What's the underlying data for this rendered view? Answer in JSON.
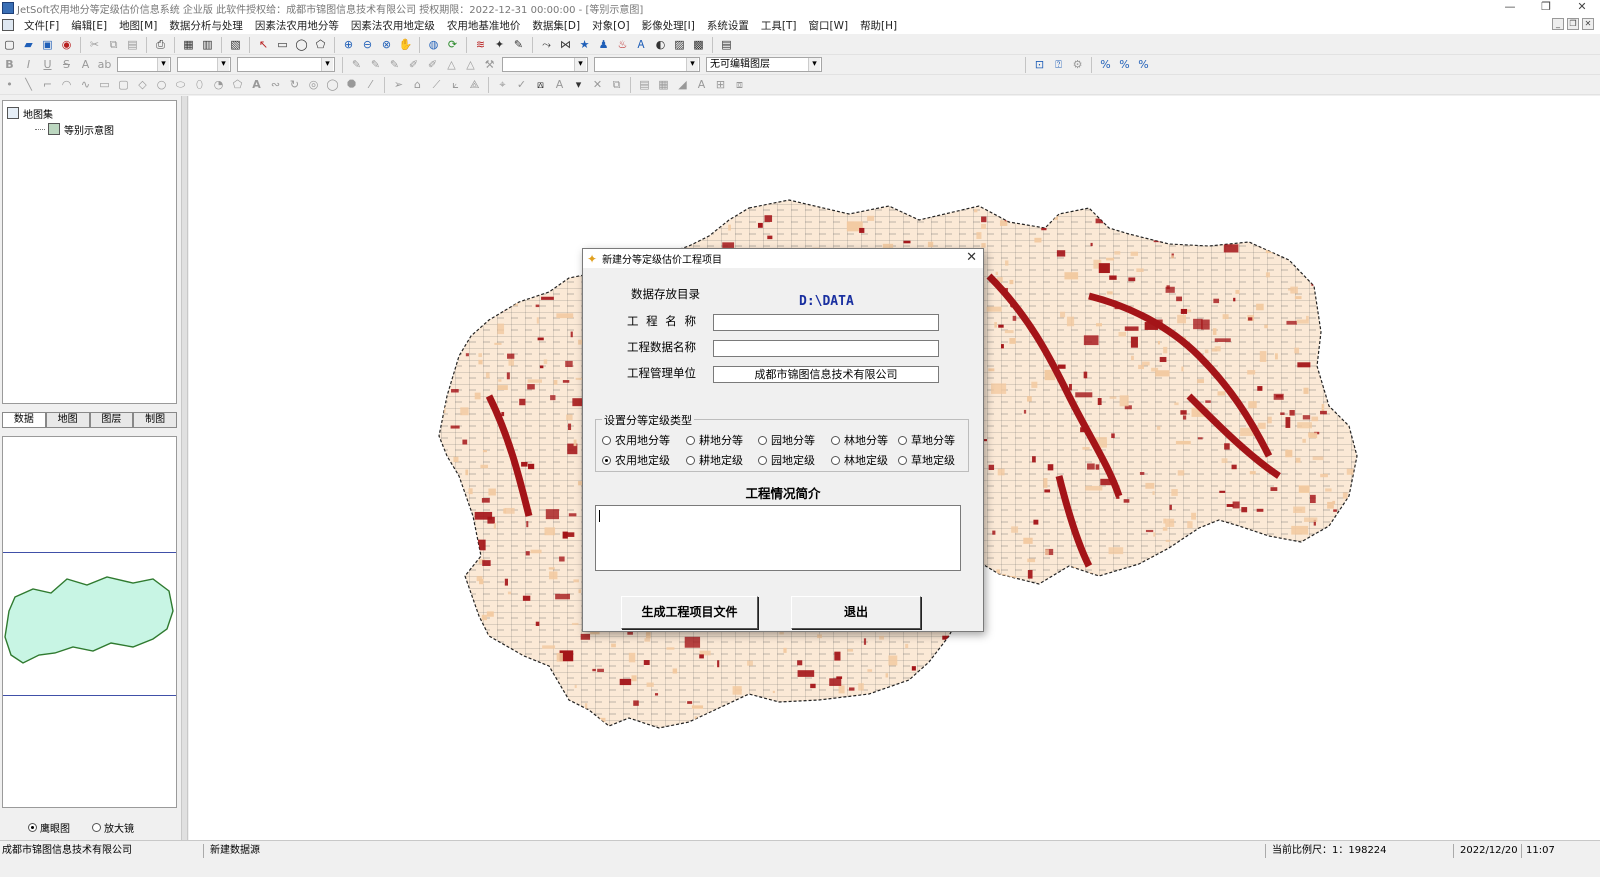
{
  "window": {
    "title": "JetSoft农用地分等定级估价信息系统 企业版 此软件授权给：成都市锦图信息技术有限公司    授权期限：2022-12-31 00:00:00 - [等别示意图]",
    "controls": [
      "—",
      "❐",
      "✕"
    ]
  },
  "menu": [
    "文件[F]",
    "编辑[E]",
    "地图[M]",
    "数据分析与处理",
    "因素法农用地分等",
    "因素法农用地定级",
    "农用地基准地价",
    "数据集[D]",
    "对象[O]",
    "影像处理[I]",
    "系统设置",
    "工具[T]",
    "窗口[W]",
    "帮助[H]"
  ],
  "toolbar": {
    "layer_combo": "无可编辑图层"
  },
  "tree": {
    "root": "地图集",
    "child": "等别示意图"
  },
  "panel_tabs": [
    "数据",
    "地图",
    "图层",
    "制图"
  ],
  "view_mode": {
    "options": [
      "鹰眼图",
      "放大镜"
    ],
    "selected": "鹰眼图"
  },
  "dialog": {
    "title": "新建分等定级估价工程项目",
    "data_dir_label": "数据存放目录",
    "data_dir_value": "D:\\DATA",
    "project_name_label": "工 程 名 称",
    "project_name_value": "",
    "project_data_label": "工程数据名称",
    "project_data_value": "",
    "project_unit_label": "工程管理单位",
    "project_unit_value": "成都市锦图信息技术有限公司",
    "type_group_title": "设置分等定级类型",
    "type_options_row1": [
      "农用地分等",
      "耕地分等",
      "园地分等",
      "林地分等",
      "草地分等"
    ],
    "type_options_row2": [
      "农用地定级",
      "耕地定级",
      "园地定级",
      "林地定级",
      "草地定级"
    ],
    "selected_type": "农用地定级",
    "intro_title": "工程情况简介",
    "intro_value": "",
    "generate_button": "生成工程项目文件",
    "exit_button": "退出"
  },
  "status": {
    "company": "成都市锦图信息技术有限公司",
    "message": "新建数据源",
    "scale": "当前比例尺：1：198224",
    "date": "2022/12/20",
    "time": "11:07"
  },
  "colors": {
    "map_dark_red": "#a41418",
    "map_light": "#f2c9a0",
    "overview_fill": "#c8f5e4",
    "dir_text": "#1a30a0"
  }
}
